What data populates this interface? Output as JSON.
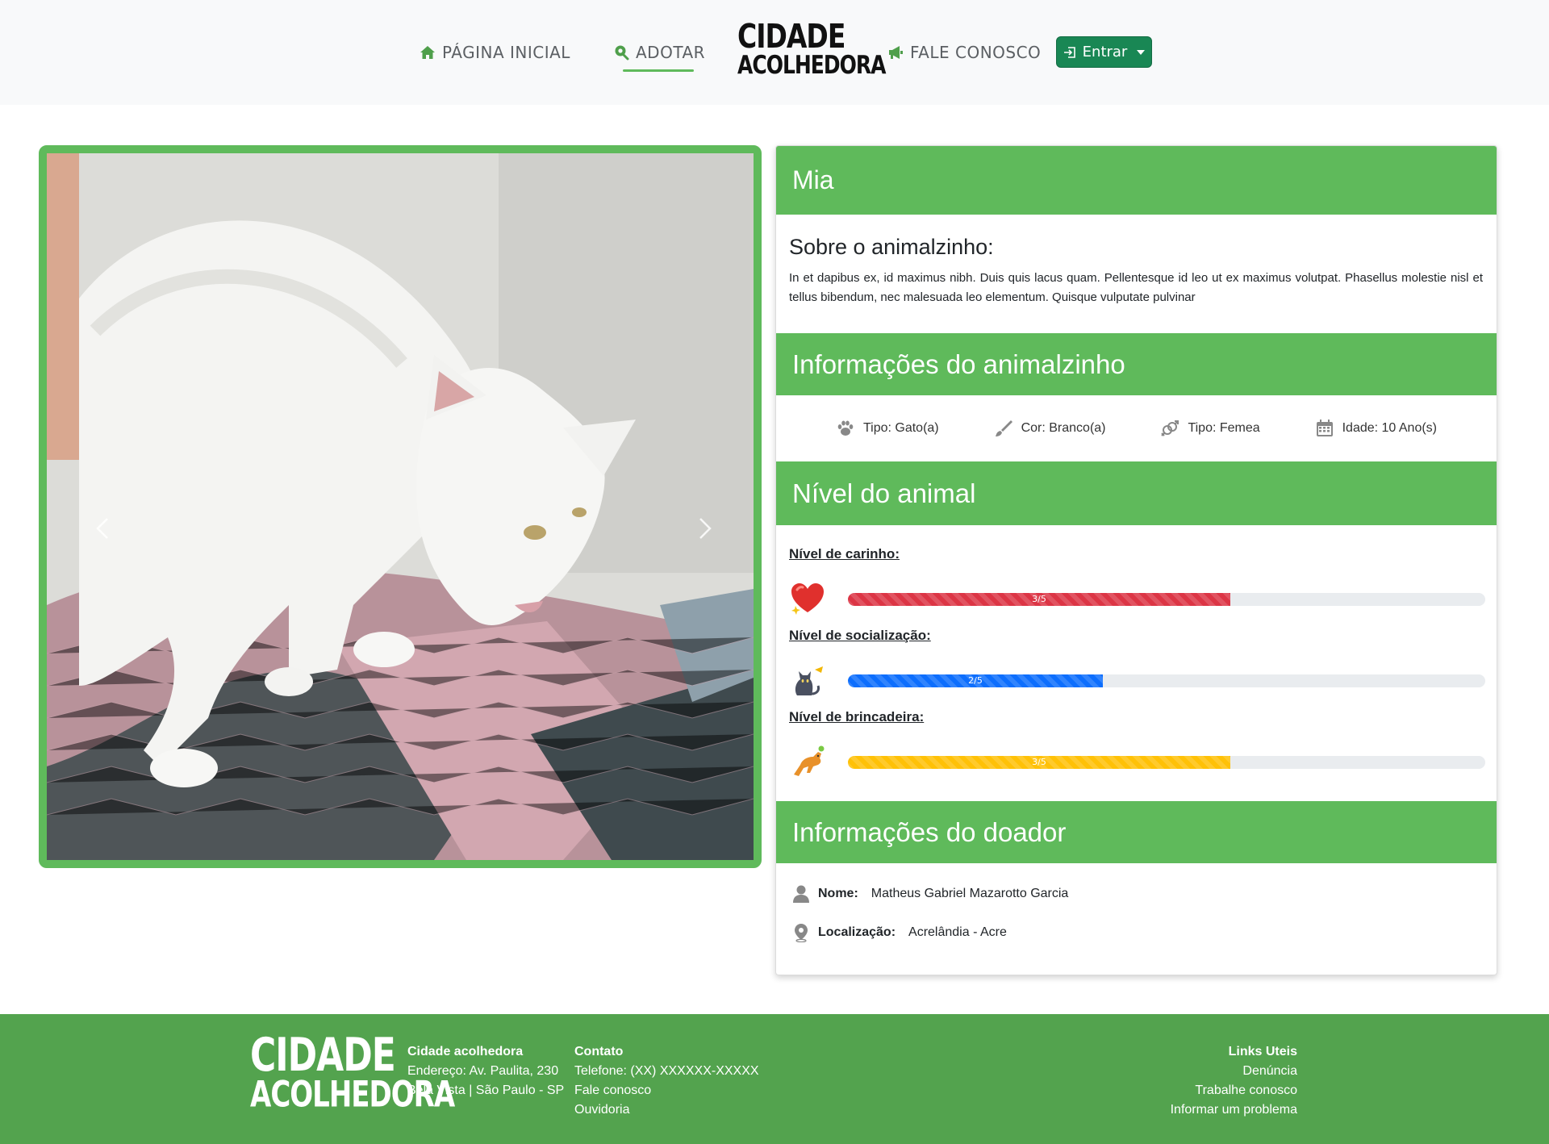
{
  "nav": {
    "home_label": "PÁGINA INICIAL",
    "adopt_label": "ADOTAR",
    "contact_label": "FALE CONOSCO",
    "login_label": "Entrar",
    "logo_line1": "CIDADE",
    "logo_line2": "ACOLHEDORA",
    "accent_color": "#5fba5b",
    "button_color": "#198754"
  },
  "pet": {
    "name": "Mia",
    "about_title": "Sobre o animalzinho:",
    "about_text": "In et dapibus ex, id maximus nibh. Duis quis lacus quam. Pellentesque id leo ut ex maximus volutpat. Phasellus molestie nisl et tellus bibendum, nec malesuada leo elementum. Quisque vulputate pulvinar",
    "info_title": "Informações do animalzinho",
    "facts": [
      {
        "icon": "paw-icon",
        "label": "Tipo: Gato(a)"
      },
      {
        "icon": "brush-icon",
        "label": "Cor: Branco(a)"
      },
      {
        "icon": "gender-icon",
        "label": "Tipo: Femea"
      },
      {
        "icon": "calendar-icon",
        "label": "Idade: 10 Ano(s)"
      }
    ],
    "levels_title": "Nível do animal",
    "levels": [
      {
        "label": "Nível de carinho:",
        "icon": "heart-icon",
        "value": 3,
        "max": 5,
        "text": "3/5",
        "color": "#dc3545"
      },
      {
        "label": "Nível de socialização:",
        "icon": "cat-icon",
        "value": 2,
        "max": 5,
        "text": "2/5",
        "color": "#0d6efd"
      },
      {
        "label": "Nível de brincadeira:",
        "icon": "playing-dog-icon",
        "value": 3,
        "max": 5,
        "text": "3/5",
        "color": "#ffc107"
      }
    ]
  },
  "donor": {
    "title": "Informações do doador",
    "name_label": "Nome:",
    "name": "Matheus Gabriel Mazarotto Garcia",
    "location_label": "Localização:",
    "location": "Acrelândia - Acre"
  },
  "footer": {
    "logo_line1": "CIDADE",
    "logo_line2": "ACOLHEDORA",
    "org_title": "Cidade acolhedora",
    "address1": "Endereço: Av. Paulita, 230",
    "address2": "Bela Vista | São Paulo - SP",
    "contact_title": "Contato",
    "phone": "Telefone: (XX) XXXXXX-XXXXX",
    "contact_link": "Fale conosco",
    "ombudsman": "Ouvidoria",
    "links_title": "Links Uteis",
    "links": [
      "Denúncia",
      "Trabalhe conosco",
      "Informar um problema"
    ],
    "bg_color": "#53a34e"
  }
}
